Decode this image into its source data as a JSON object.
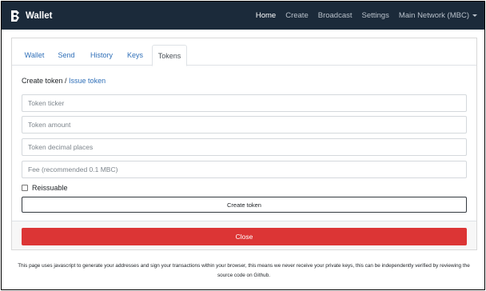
{
  "navbar": {
    "brand": "Wallet",
    "items": [
      {
        "label": "Home",
        "active": true
      },
      {
        "label": "Create",
        "active": false
      },
      {
        "label": "Broadcast",
        "active": false
      },
      {
        "label": "Settings",
        "active": false
      },
      {
        "label": "Main Network (MBC)",
        "active": false,
        "dropdown": true
      }
    ]
  },
  "tabs": [
    {
      "label": "Wallet",
      "active": false
    },
    {
      "label": "Send",
      "active": false
    },
    {
      "label": "History",
      "active": false
    },
    {
      "label": "Keys",
      "active": false
    },
    {
      "label": "Tokens",
      "active": true
    }
  ],
  "tokens": {
    "crumb_current": "Create token",
    "crumb_separator": " / ",
    "crumb_link": "Issue token",
    "fields": {
      "ticker_placeholder": "Token ticker",
      "amount_placeholder": "Token amount",
      "decimals_placeholder": "Token decimal places",
      "fee_placeholder": "Fee (recommended 0.1 MBC)"
    },
    "reissuable_label": "Reissuable",
    "reissuable_checked": false,
    "create_button": "Create token"
  },
  "close_button": "Close",
  "footer_text": "This page uses javascript to generate your addresses and sign your transactions within your browser, this means we never receive your private keys, this can be independently verified by reviewing the source code on Github.",
  "colors": {
    "navbar_bg": "#1b2a3a",
    "link": "#2f6fb8",
    "danger": "#dc3535"
  }
}
